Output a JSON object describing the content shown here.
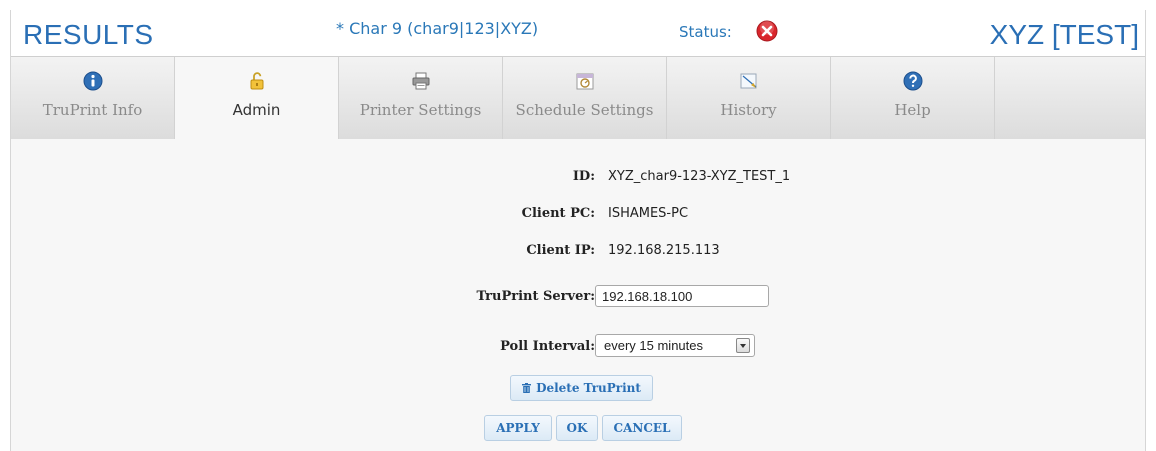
{
  "header": {
    "results_title": "RESULTS",
    "char_title": "* Char 9 (char9|123|XYZ)",
    "status_label": "Status:",
    "status_icon": "error-x-icon",
    "right_title": "XYZ [TEST]"
  },
  "tabs": [
    {
      "label": "TruPrint Info",
      "icon": "info-icon",
      "active": false
    },
    {
      "label": "Admin",
      "icon": "unlock-icon",
      "active": true
    },
    {
      "label": "Printer Settings",
      "icon": "printer-icon",
      "active": false
    },
    {
      "label": "Schedule Settings",
      "icon": "schedule-icon",
      "active": false
    },
    {
      "label": "History",
      "icon": "history-icon",
      "active": false
    },
    {
      "label": "Help",
      "icon": "help-icon",
      "active": false
    }
  ],
  "form": {
    "id_label": "ID:",
    "id_value": "XYZ_char9-123-XYZ_TEST_1",
    "client_pc_label": "Client PC:",
    "client_pc_value": "ISHAMES-PC",
    "client_ip_label": "Client IP:",
    "client_ip_value": "192.168.215.113",
    "server_label": "TruPrint Server:",
    "server_value": "192.168.18.100",
    "poll_label": "Poll Interval:",
    "poll_value": "every 15 minutes"
  },
  "buttons": {
    "delete": "Delete TruPrint",
    "apply": "APPLY",
    "ok": "OK",
    "cancel": "CANCEL"
  },
  "colors": {
    "accent": "#2a6fb5",
    "status_error": "#d9262c"
  }
}
